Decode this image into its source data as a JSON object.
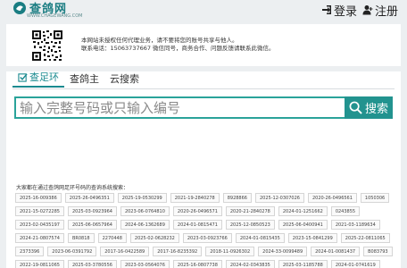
{
  "header": {
    "logo_text": "查鸽网",
    "logo_url": "WWW.CHAGEWANG.COM",
    "login_label": "登录",
    "register_label": "注册"
  },
  "notice": {
    "line1": "本网站未授权任何代理业务，请不要将您的账号共享与他人。",
    "line2": "联系电话：15063737667 微信同号，商务合作、问题反馈请联系此微信。"
  },
  "tabs": [
    {
      "label": "查足环",
      "active": true
    },
    {
      "label": "查鸽主",
      "active": false
    },
    {
      "label": "云搜索",
      "active": false
    }
  ],
  "search": {
    "placeholder": "输入完整号码或只输入编号",
    "button_label": "搜索"
  },
  "recent": {
    "label": "大家都在通过查鸽网足环号码的查询系统搜索：",
    "items": [
      "2025-16-009386",
      "2025-26-0496351",
      "2025-19-0530299",
      "2021-19-2840278",
      "8928866",
      "2025-12-0307026",
      "2020-26-0496561",
      "1050306",
      "2021-15-0272285",
      "2025-03-0923964",
      "2023-06-0764810",
      "2020-26-0496571",
      "2020-21-2840278",
      "2024-01-1251662",
      "0243855",
      "2023-02-0435197",
      "2025-06-0657964",
      "2024-06-1362689",
      "2024-01-0815471",
      "2025-12-0850523",
      "2025-06-0400941",
      "2021-03-1189634",
      "2024-21-0807574",
      "BR0818",
      "2270448",
      "2025-02-0628232",
      "2023-03-0923766",
      "2024-01-0815435",
      "2023-15-0841299",
      "2025-22-0811065",
      "2373396",
      "2023-06-0391792",
      "2017-16-0422589",
      "2017-16-8235392",
      "2018-11-0926302",
      "2024-33-0099489",
      "2024-01-0081437",
      "B083793",
      "2022-19-0811065",
      "2025-03-3780556",
      "2023-03-0564076",
      "2025-16-0807738",
      "2024-02-0343835",
      "2025-03-1185788",
      "2024-01-0741619"
    ]
  },
  "colors": {
    "accent": "#22938f",
    "background": "#eceff1"
  }
}
